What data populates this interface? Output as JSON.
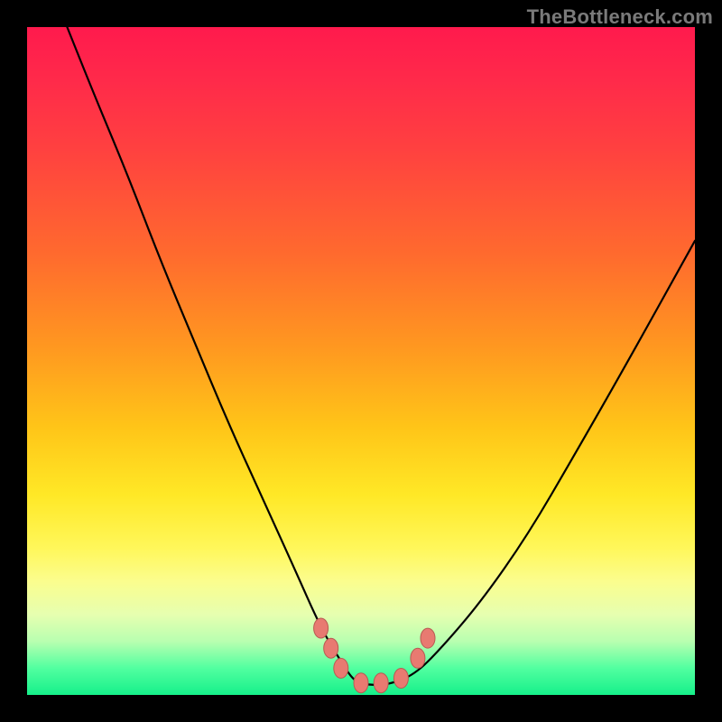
{
  "watermark": "TheBottleneck.com",
  "colors": {
    "background": "#000000",
    "gradient_top": "#ff1a4d",
    "gradient_mid": "#ffe826",
    "gradient_bottom": "#16f08a",
    "curve": "#000000",
    "marker_fill": "#e87a71"
  },
  "chart_data": {
    "type": "line",
    "title": "",
    "xlabel": "",
    "ylabel": "",
    "xlim": [
      0,
      100
    ],
    "ylim": [
      0,
      100
    ],
    "grid": false,
    "legend": false,
    "note": "Axes have no visible tick labels; x and y are in percent of plot width/height (0,0 = bottom-left). One black curve plus a handful of salmon-colored markers near the minimum.",
    "series": [
      {
        "name": "bottleneck-curve",
        "x": [
          6,
          10,
          15,
          20,
          25,
          30,
          35,
          40,
          44,
          47,
          49,
          51,
          54,
          58,
          62,
          68,
          75,
          82,
          90,
          100
        ],
        "y": [
          100,
          90,
          78,
          65,
          53,
          41,
          30,
          19,
          10,
          5,
          2,
          1.5,
          1.5,
          3,
          7,
          14,
          24,
          36,
          50,
          68
        ]
      }
    ],
    "markers": [
      {
        "x": 44.0,
        "y": 10.0
      },
      {
        "x": 45.5,
        "y": 7.0
      },
      {
        "x": 47.0,
        "y": 4.0
      },
      {
        "x": 50.0,
        "y": 1.8
      },
      {
        "x": 53.0,
        "y": 1.8
      },
      {
        "x": 56.0,
        "y": 2.5
      },
      {
        "x": 58.5,
        "y": 5.5
      },
      {
        "x": 60.0,
        "y": 8.5
      }
    ]
  }
}
